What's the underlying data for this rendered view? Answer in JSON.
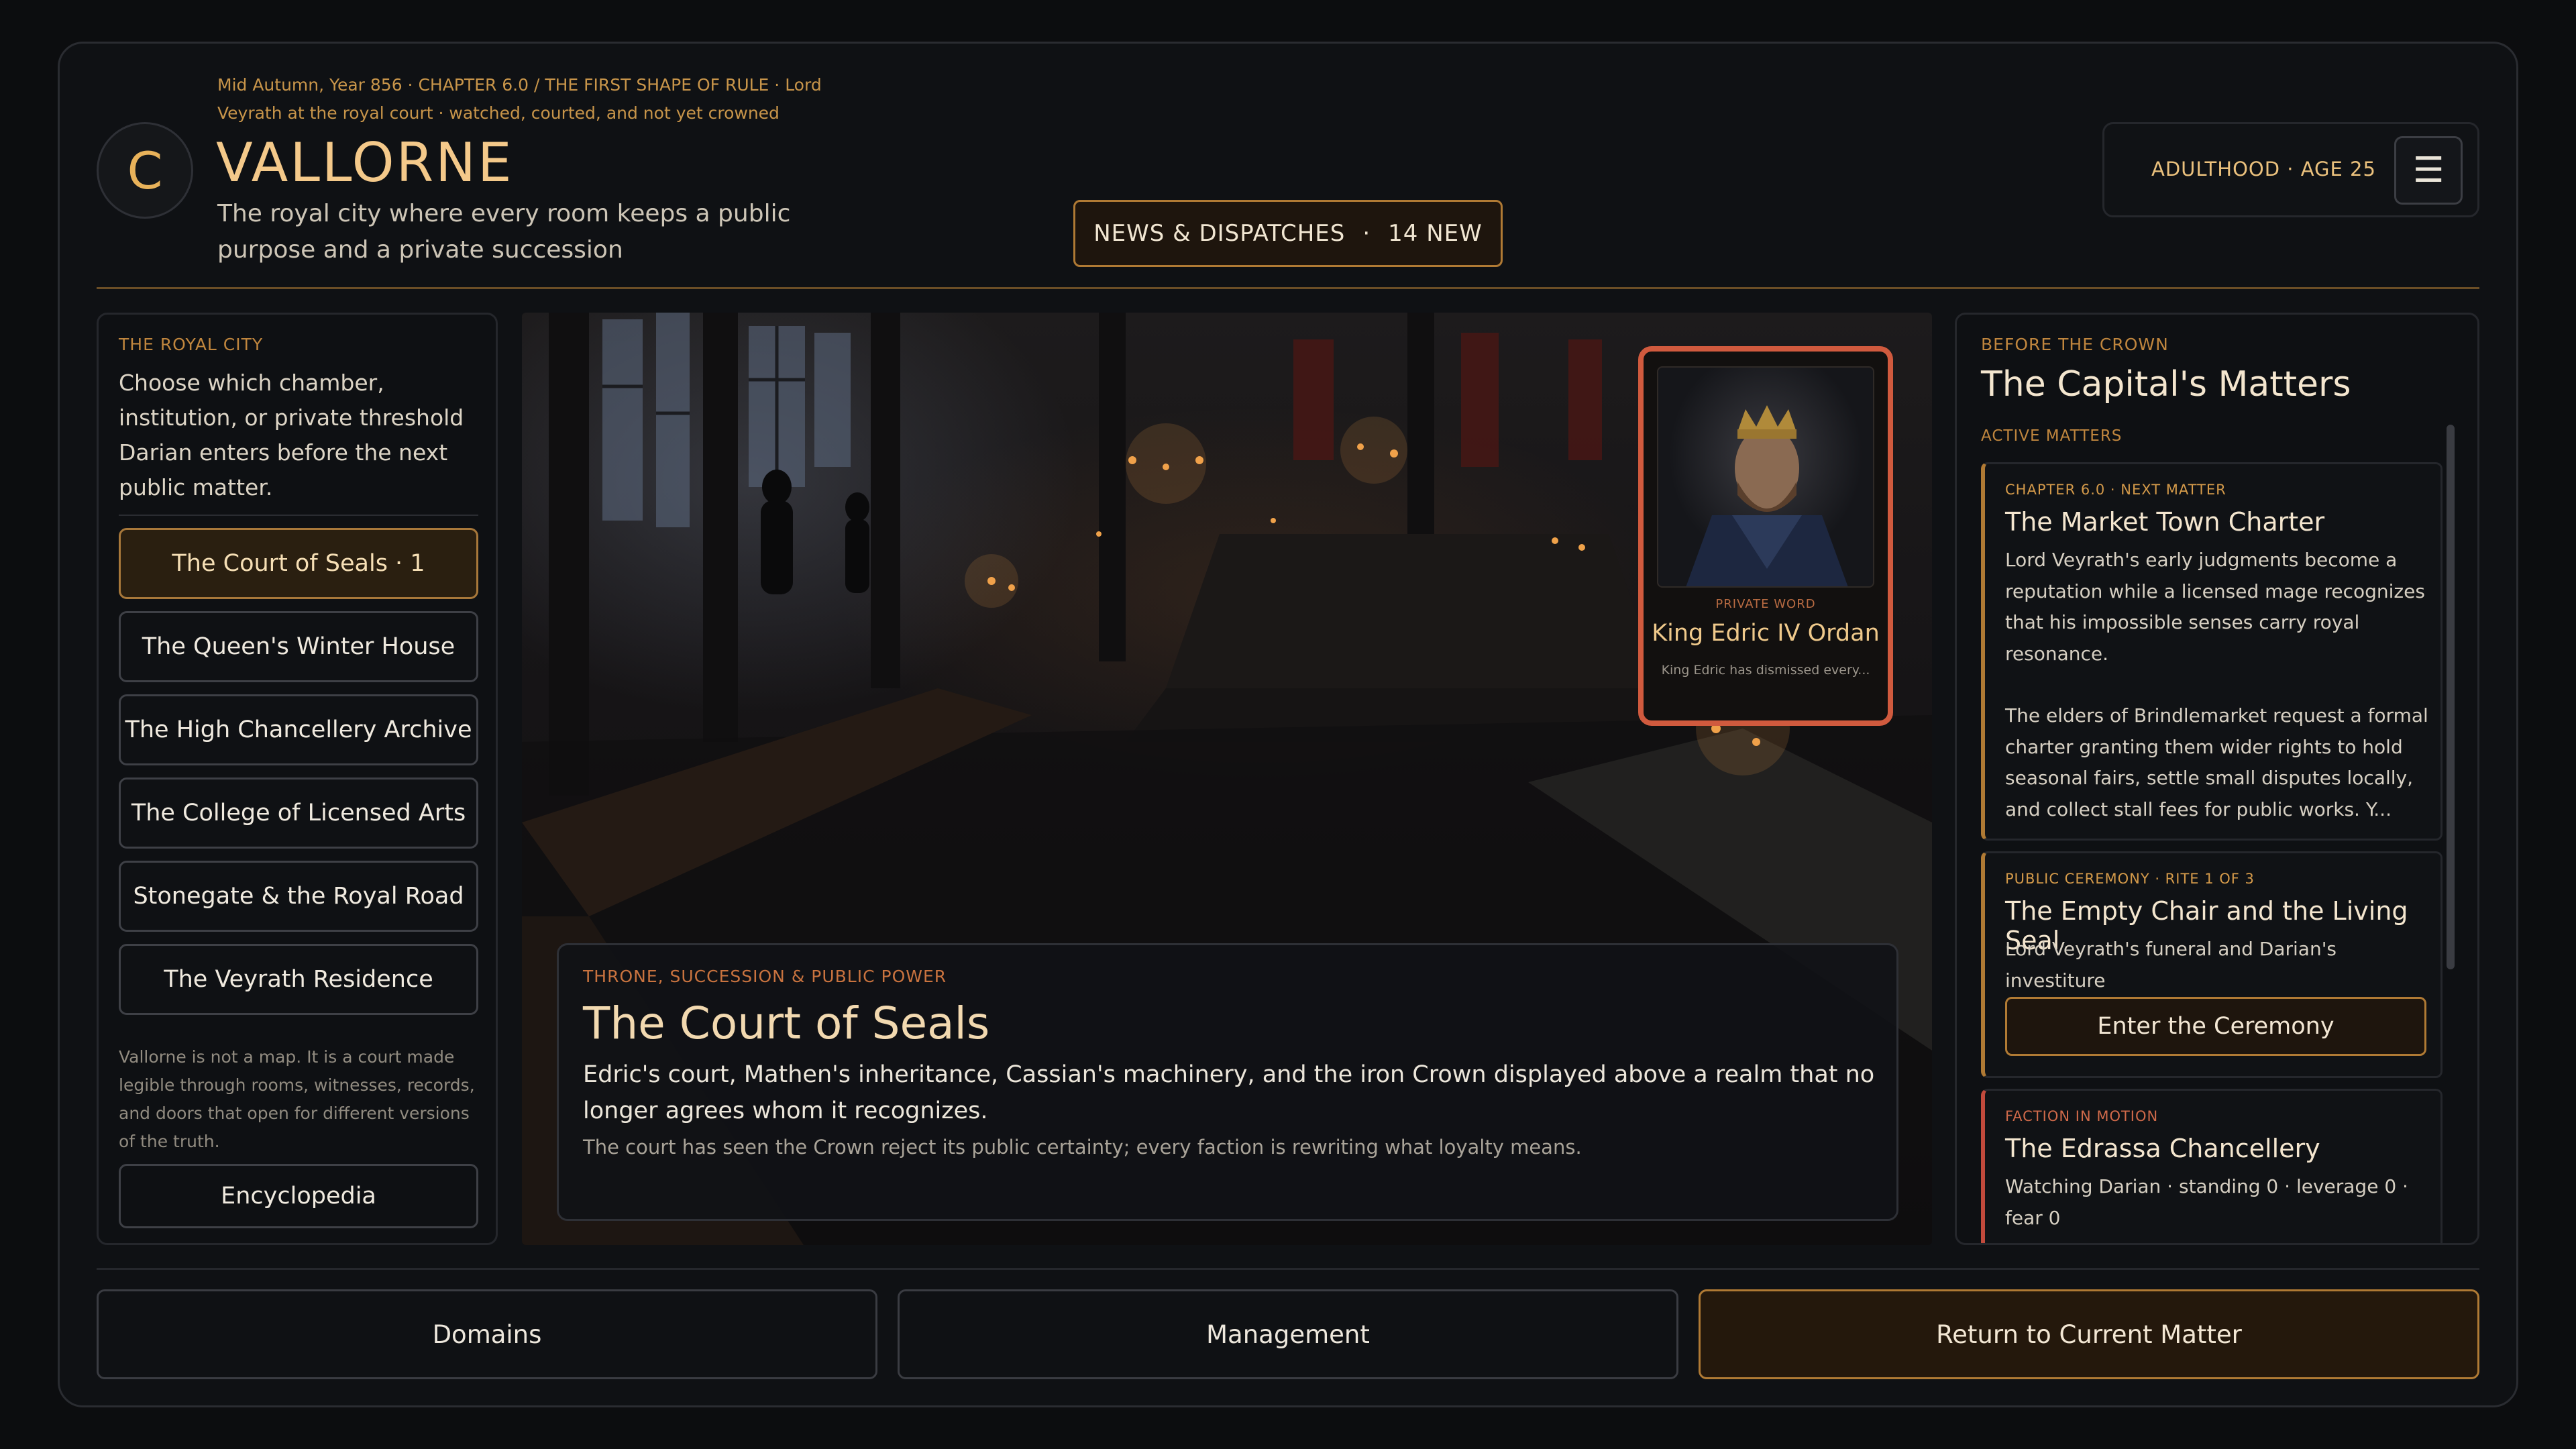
{
  "header": {
    "crest_letter": "C",
    "meta": "Mid Autumn, Year 856 · CHAPTER 6.0 / THE FIRST SHAPE OF RULE · Lord Veyrath at the royal court · watched, courted, and not yet crowned",
    "title": "VALLORNE",
    "subtitle": "The royal city where every room keeps a public purpose and a private succession",
    "news_label": "NEWS & DISPATCHES",
    "news_sep": "·",
    "news_count": "14 NEW",
    "age_label": "ADULTHOOD · AGE 25",
    "menu_icon": "hamburger-menu-icon"
  },
  "left": {
    "eyebrow": "THE ROYAL CITY",
    "intro": "Choose which chamber, institution, or private threshold Darian enters before the next public matter.",
    "locations": [
      {
        "label": "The Court of Seals  ·  1",
        "active": true
      },
      {
        "label": "The Queen's Winter House",
        "active": false
      },
      {
        "label": "The High Chancellery Archive",
        "active": false
      },
      {
        "label": "The College of Licensed Arts",
        "active": false
      },
      {
        "label": "Stonegate & the Royal Road",
        "active": false
      },
      {
        "label": "The Veyrath Residence",
        "active": false
      }
    ],
    "note": "Vallorne is not a map. It is a court made legible through rooms, witnesses, records, and doors that open for different versions of the truth.",
    "encyclopedia": "Encyclopedia"
  },
  "scene": {
    "eyebrow": "THRONE, SUCCESSION & PUBLIC POWER",
    "title": "The Court of Seals",
    "description": "Edric's court, Mathen's inheritance, Cassian's machinery, and the iron Crown displayed above a realm that no longer agrees whom it recognizes.",
    "subtext": "The court has seen the Crown reject its public certainty; every faction is rewriting what loyalty means.",
    "portrait": {
      "eyebrow": "PRIVATE WORD",
      "name": "King Edric IV Ordan",
      "text": "King Edric has dismissed every..."
    }
  },
  "right": {
    "eyebrow": "BEFORE THE CROWN",
    "title": "The Capital's Matters",
    "label": "ACTIVE MATTERS",
    "matters": [
      {
        "eyebrow": "CHAPTER 6.0 · NEXT MATTER",
        "title": "The Market Town Charter",
        "body1": "Lord Veyrath's early judgments become a reputation while a licensed mage recognizes that his impossible senses carry royal resonance.",
        "body2": "The elders of Brindlemarket request a formal charter granting them wider rights to hold seasonal fairs, settle small disputes locally, and collect stall fees for public works. Y..."
      },
      {
        "eyebrow": "PUBLIC CEREMONY · RITE 1 OF 3",
        "title": "The Empty Chair and the Living Seal",
        "body": "Lord Veyrath's funeral and Darian's investiture",
        "button": "Enter the Ceremony"
      },
      {
        "eyebrow": "FACTION IN MOTION",
        "title": "The Edrassa Chancellery",
        "body": "Watching Darian · standing 0 · leverage 0 · fear 0"
      }
    ]
  },
  "footer": {
    "domains": "Domains",
    "management": "Management",
    "return": "Return to Current Matter"
  },
  "colors": {
    "accent": "#b07a34",
    "gold_text": "#f4c98a",
    "portrait_border": "#d05a3e",
    "faction_red": "#c24a3c"
  }
}
